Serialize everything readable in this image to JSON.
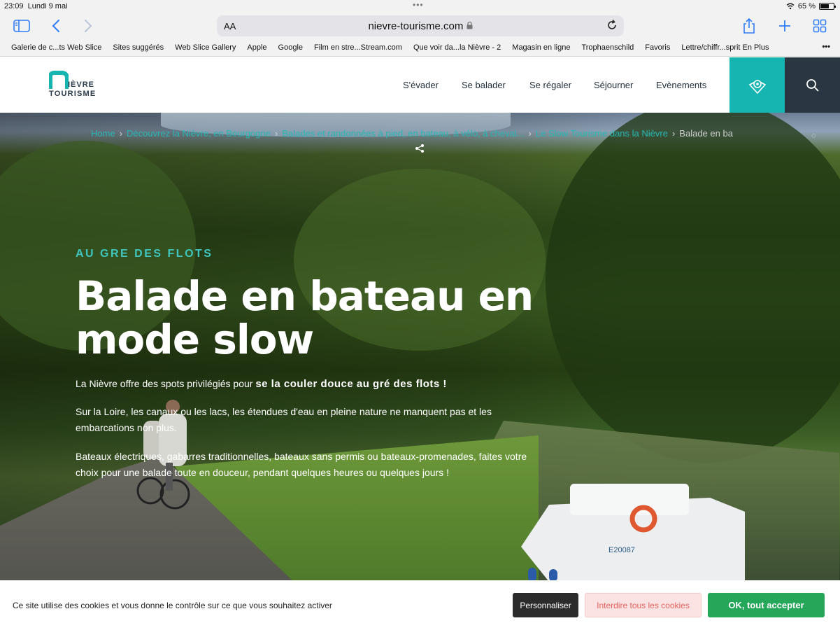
{
  "status": {
    "time": "23:09",
    "date": "Lundi 9 mai",
    "battery": "65 %"
  },
  "browser": {
    "text_size_label": "AA",
    "url": "nievre-tourisme.com"
  },
  "bookmarks": [
    "Galerie de c...ts Web Slice",
    "Sites suggérés",
    "Web Slice Gallery",
    "Apple",
    "Google",
    "Film en stre...Stream.com",
    "Que voir da...la Nièvre - 2",
    "Magasin en ligne",
    "Trophaenschild",
    "Favoris",
    "Lettre/chiffr...sprit En Plus"
  ],
  "logo": {
    "line1": "IÈVRE",
    "line2": "TOURISME"
  },
  "nav": {
    "items": [
      "S'évader",
      "Se balader",
      "Se régaler",
      "Séjourner",
      "Evènements"
    ]
  },
  "breadcrumb": {
    "items": [
      "Home",
      "Découvrez la Nièvre, en Bourgogne",
      "Balades et randonnées à pied, en bateau, à vélo, à cheval...",
      "Le Slow Tourisme dans la Nièvre"
    ],
    "current": "Balade en ba"
  },
  "hero": {
    "kicker": "AU GRE DES FLOTS",
    "title_line1": "Balade en bateau en",
    "title_line2": "mode slow",
    "p1_start": "La Nièvre offre des spots privilégiés pour ",
    "p1_strong": "se la couler douce au gré des flots !",
    "p2": "Sur la Loire, les canaux ou les lacs, les étendues d'eau en pleine nature ne manquent pas et les embarcations non plus.",
    "p3": "Bateaux électriques, gabarres traditionnelles, bateaux sans permis ou bateaux-promenades, faites votre choix pour une balade toute en douceur, pendant quelques heures ou quelques jours !",
    "boat_id": "E20087"
  },
  "cookie": {
    "text": "Ce site utilise des cookies et vous donne le contrôle sur ce que vous souhaitez activer",
    "personalize": "Personnaliser",
    "deny": "Interdire tous les cookies",
    "accept": "OK, tout accepter"
  },
  "colors": {
    "teal": "#17b5b2",
    "dark": "#2a3742",
    "accept": "#25a75a",
    "deny_text": "#e2625d"
  }
}
